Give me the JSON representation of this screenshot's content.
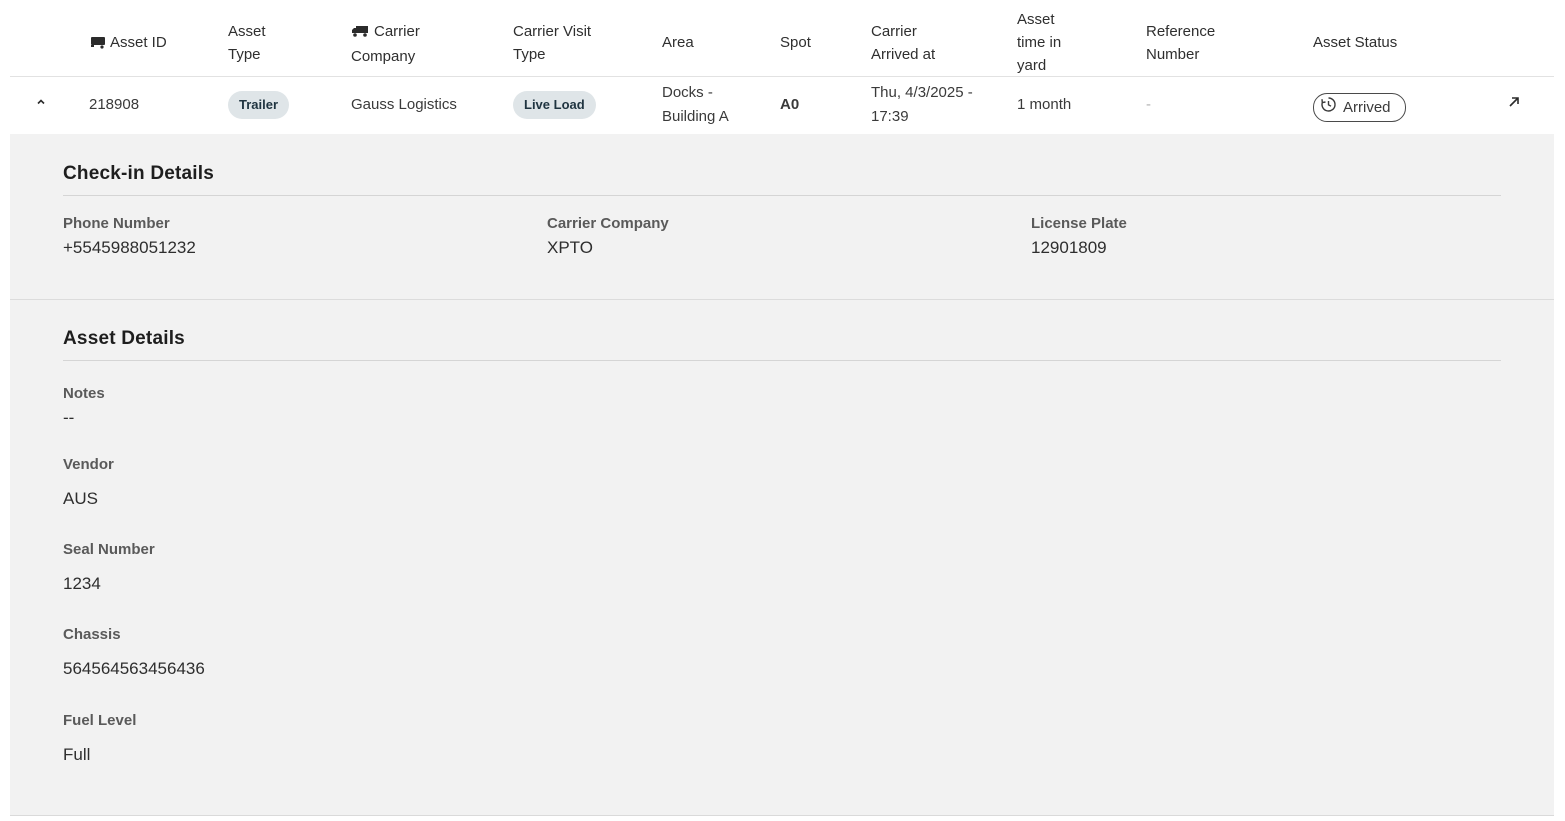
{
  "table": {
    "headers": {
      "asset_id": "Asset ID",
      "asset_type_1": "Asset",
      "asset_type_2": "Type",
      "carrier_company_1": "Carrier",
      "carrier_company_2": "Company",
      "visit_type_1": "Carrier Visit",
      "visit_type_2": "Type",
      "area": "Area",
      "spot": "Spot",
      "arrived_1": "Carrier",
      "arrived_2": "Arrived at",
      "time_1": "Asset",
      "time_2": "time in",
      "time_3": "yard",
      "reference_1": "Reference",
      "reference_2": "Number",
      "status": "Asset Status"
    },
    "row": {
      "asset_id": "218908",
      "asset_type": "Trailer",
      "carrier_company": "Gauss Logistics",
      "visit_type": "Live Load",
      "area_1": "Docks -",
      "area_2": "Building A",
      "spot": "A0",
      "arrived_1": "Thu, 4/3/2025 -",
      "arrived_2": "17:39",
      "time_in_yard": "1 month",
      "reference": "-",
      "status": "Arrived"
    },
    "icons": {
      "asset_id": "trailer-icon",
      "carrier": "truck-icon",
      "expand": "chevron-up-icon",
      "status": "clock-history-icon",
      "open": "arrow-up-right-icon"
    }
  },
  "checkin": {
    "title": "Check-in Details",
    "phone_label": "Phone Number",
    "phone_value": "+5545988051232",
    "carrier_label": "Carrier Company",
    "carrier_value": "XPTO",
    "plate_label": "License Plate",
    "plate_value": "12901809"
  },
  "asset": {
    "title": "Asset Details",
    "notes_label": "Notes",
    "notes_value": "--",
    "vendor_label": "Vendor",
    "vendor_value": "AUS",
    "seal_label": "Seal Number",
    "seal_value": "1234",
    "chassis_label": "Chassis",
    "chassis_value": "564564563456436",
    "fuel_label": "Fuel Level",
    "fuel_value": "Full"
  }
}
